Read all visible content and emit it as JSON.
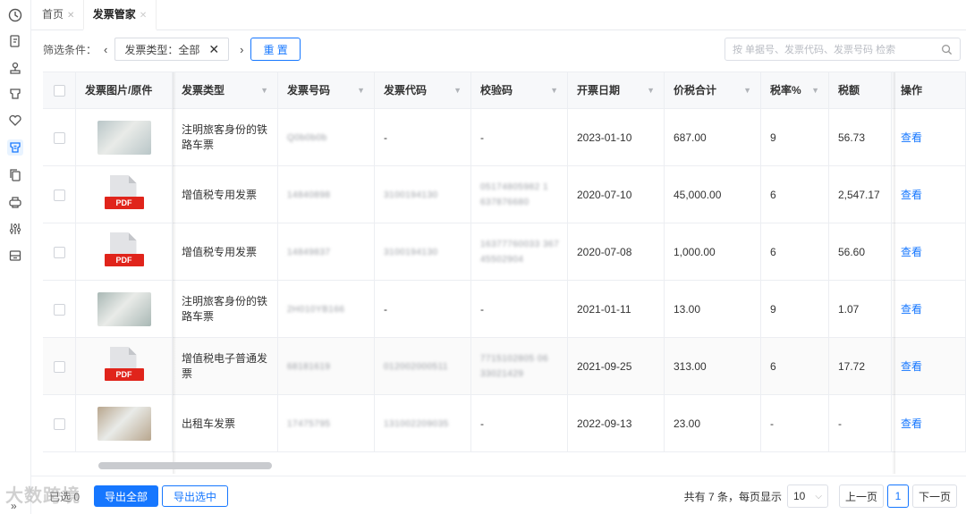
{
  "tabs": {
    "home": "首页",
    "current": "发票管家"
  },
  "filter": {
    "label": "筛选条件：",
    "chip_key": "发票类型：",
    "chip_value": "全部",
    "reset": "重 置"
  },
  "search": {
    "placeholder": "按 单据号、发票代码、发票号码 检索"
  },
  "table": {
    "headers": [
      "发票图片/原件",
      "发票类型",
      "发票号码",
      "发票代码",
      "校验码",
      "开票日期",
      "价税合计",
      "税率%",
      "税额",
      "操作"
    ],
    "rows": [
      {
        "thumb": "photo",
        "thumb_color": "#b9c6c8",
        "type": "注明旅客身份的铁路车票",
        "number": "Q0b0b0b",
        "code": "-",
        "check": "-",
        "date": "2023-01-10",
        "total": "687.00",
        "rate": "9",
        "tax": "56.73",
        "action": "查看"
      },
      {
        "thumb": "pdf",
        "pdf_label": "PDF",
        "type": "增值税专用发票",
        "number": "14840898",
        "code": "3100194130",
        "check": "05174805982 1 637876680",
        "date": "2020-07-10",
        "total": "45,000.00",
        "rate": "6",
        "tax": "2,547.17",
        "action": "查看"
      },
      {
        "thumb": "pdf",
        "pdf_label": "PDF",
        "type": "增值税专用发票",
        "number": "14849837",
        "code": "3100194130",
        "check": "16377760033 367 45502904",
        "date": "2020-07-08",
        "total": "1,000.00",
        "rate": "6",
        "tax": "56.60",
        "action": "查看"
      },
      {
        "thumb": "photo",
        "thumb_color": "#a9b8b5",
        "type": "注明旅客身份的铁路车票",
        "number": "2H010YB166",
        "code": "-",
        "check": "-",
        "date": "2021-01-11",
        "total": "13.00",
        "rate": "9",
        "tax": "1.07",
        "action": "查看"
      },
      {
        "thumb": "pdf",
        "pdf_label": "PDF",
        "type": "增值税电子普通发票",
        "number": "68181619",
        "code": "012002000511",
        "check": "7715102805 06 33021429",
        "date": "2021-09-25",
        "total": "313.00",
        "rate": "6",
        "tax": "17.72",
        "action": "查看"
      },
      {
        "thumb": "photo",
        "thumb_color": "#b8a68e",
        "type": "出租车发票",
        "number": "17475795",
        "code": "131002209035",
        "check": "-",
        "date": "2022-09-13",
        "total": "23.00",
        "rate": "-",
        "tax": "-",
        "action": "查看"
      }
    ]
  },
  "footer": {
    "selected": "已选 0",
    "export_all": "导出全部",
    "export_selected": "导出选中",
    "total_text": "共有 7 条，每页显示",
    "page_size": "10",
    "prev": "上一页",
    "page": "1",
    "next": "下一页"
  },
  "watermark": "大数跨境",
  "colors": {
    "accent": "#1677ff",
    "pdf_red": "#e0241b"
  }
}
